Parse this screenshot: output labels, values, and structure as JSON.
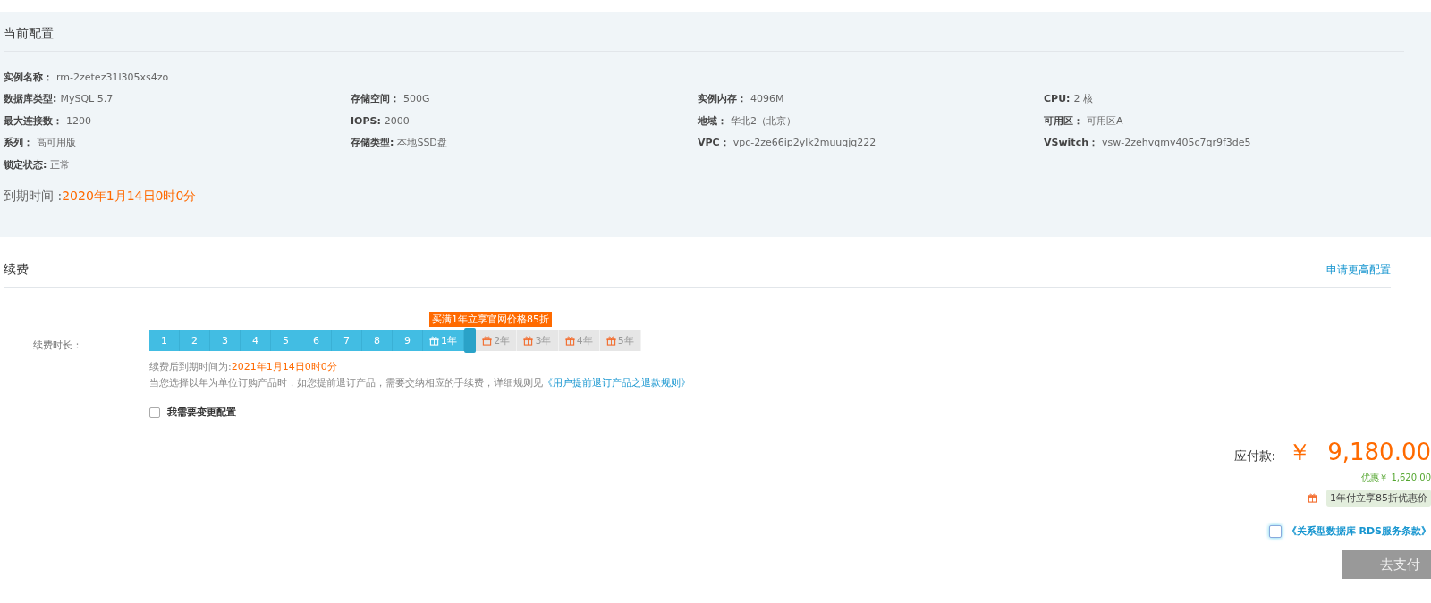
{
  "current_config": {
    "title": "当前配置",
    "rows": [
      [
        {
          "label": "实例名称：",
          "value": "rm-2zetez31l305xs4zo"
        }
      ],
      [
        {
          "label": "数据库类型:",
          "value": "MySQL 5.7"
        },
        {
          "label": "存储空间：",
          "value": "500G"
        },
        {
          "label": "实例内存：",
          "value": "4096M"
        },
        {
          "label": "CPU:",
          "value": "2 核"
        }
      ],
      [
        {
          "label": "最大连接数：",
          "value": "1200"
        },
        {
          "label": "IOPS:",
          "value": "2000"
        },
        {
          "label": "地域：",
          "value": "华北2（北京）"
        },
        {
          "label": "可用区：",
          "value": "可用区A"
        }
      ],
      [
        {
          "label": "系列：",
          "value": "高可用版"
        },
        {
          "label": "存储类型:",
          "value": "本地SSD盘"
        },
        {
          "label": "VPC：",
          "value": "vpc-2ze66ip2ylk2muuqjq222"
        },
        {
          "label": "VSwitch：",
          "value": "vsw-2zehvqmv405c7qr9f3de5"
        }
      ],
      [
        {
          "label": "锁定状态:",
          "value": "正常"
        }
      ]
    ],
    "expiry_label": "到期时间 :",
    "expiry_value": "2020年1月14日0时0分"
  },
  "renewal": {
    "title": "续费",
    "upgrade_link": "申请更高配置",
    "duration_label": "续费时长：",
    "tooltip": "买满1年立享官网价格85折",
    "level": 0.656,
    "options": [
      {
        "label": "1",
        "kind": "month"
      },
      {
        "label": "2",
        "kind": "month"
      },
      {
        "label": "3",
        "kind": "month"
      },
      {
        "label": "4",
        "kind": "month"
      },
      {
        "label": "5",
        "kind": "month"
      },
      {
        "label": "6",
        "kind": "month"
      },
      {
        "label": "7",
        "kind": "month"
      },
      {
        "label": "8",
        "kind": "month"
      },
      {
        "label": "9",
        "kind": "month"
      },
      {
        "label": "1年",
        "kind": "gift"
      },
      {
        "label": "2年",
        "kind": "gift"
      },
      {
        "label": "3年",
        "kind": "gift"
      },
      {
        "label": "4年",
        "kind": "gift"
      },
      {
        "label": "5年",
        "kind": "gift"
      }
    ],
    "new_expiry_label": "续费后到期时间为:",
    "new_expiry_value": "2021年1月14日0时0分",
    "notice": "当您选择以年为单位订购产品时，如您提前退订产品，需要交纳相应的手续费，详细规则见",
    "notice_link": "《用户提前退订产品之退款规则》",
    "change_config": {
      "label": "我需要变更配置",
      "checked": false
    }
  },
  "payment": {
    "label": "应付款:",
    "currency": "￥",
    "amount": "9,180.00",
    "discount": "优惠￥ 1,620.00",
    "promo": "1年付立享85折优惠价",
    "terms": {
      "link": "《关系型数据库 RDS服务条款》",
      "checked": false
    },
    "pay_button": "去支付"
  }
}
